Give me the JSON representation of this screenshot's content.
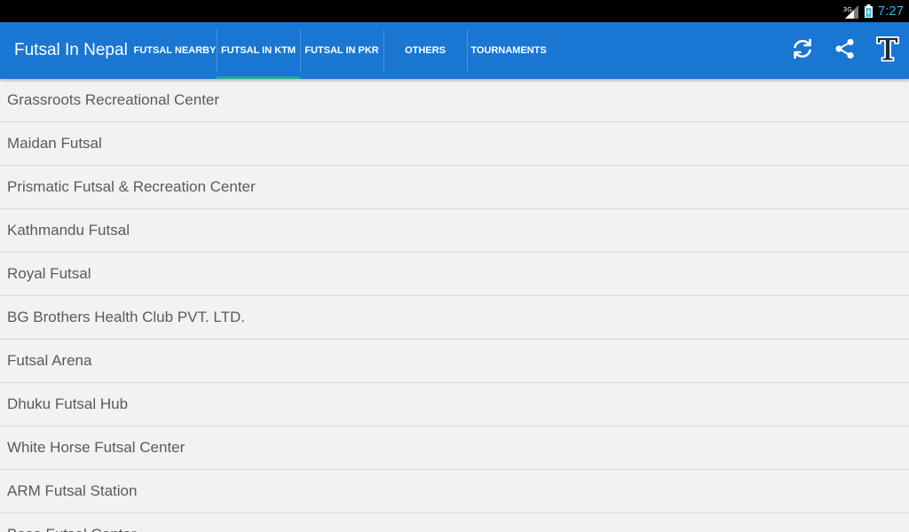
{
  "status_bar": {
    "network": "3G",
    "time": "7:27",
    "colors": {
      "clock": "#33b5e5",
      "background": "#000000"
    }
  },
  "action_bar": {
    "title": "Futsal In Nepal",
    "color": "#1976d2",
    "tabs": [
      {
        "label": "FUTSAL NEARBY",
        "active": false
      },
      {
        "label": "FUTSAL IN KTM",
        "active": true
      },
      {
        "label": "FUTSAL IN PKR",
        "active": false
      },
      {
        "label": "OTHERS",
        "active": false
      },
      {
        "label": "TOURNAMENTS",
        "active": false
      }
    ],
    "actions": [
      "refresh-icon",
      "share-icon",
      "font-icon"
    ]
  },
  "list": {
    "items": [
      "Grassroots Recreational Center",
      "Maidan Futsal",
      "Prismatic Futsal & Recreation Center",
      "Kathmandu Futsal",
      "Royal Futsal",
      "BG Brothers Health Club PVT. LTD.",
      "Futsal Arena",
      "Dhuku Futsal Hub",
      "White Horse Futsal Center",
      "ARM Futsal Station",
      "Base Futsal Center"
    ]
  }
}
